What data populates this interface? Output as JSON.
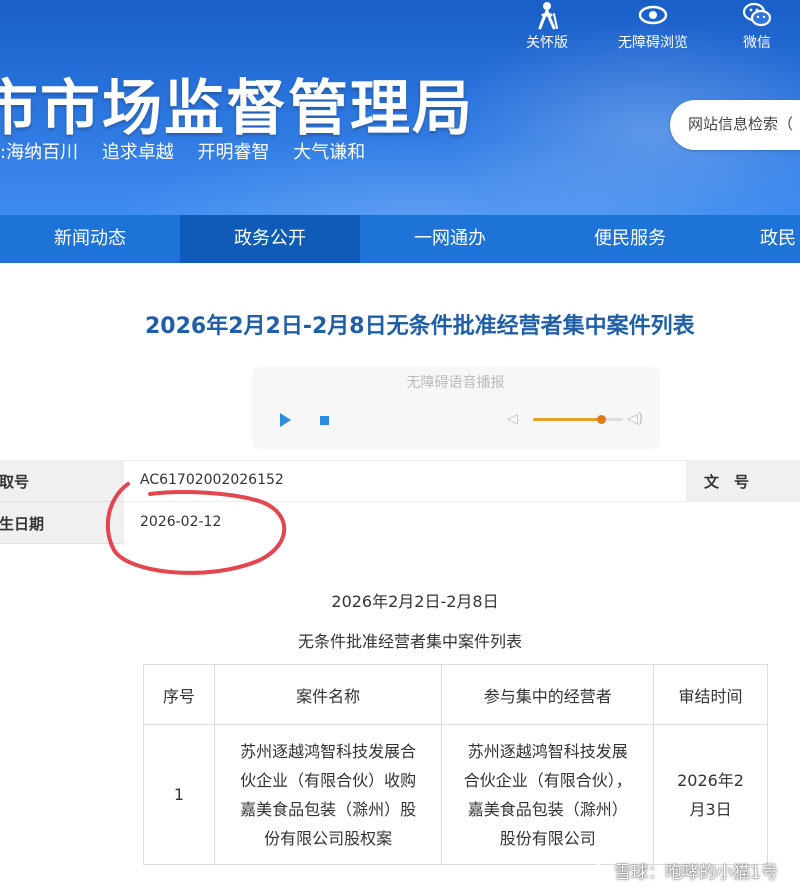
{
  "header": {
    "site_title": "市市场监督管理局",
    "slogan": [
      ":海纳百川",
      "追求卓越",
      "开明睿智",
      "大气谦和"
    ],
    "tools": [
      {
        "label": "关怀版",
        "icon": "elderly-care-icon"
      },
      {
        "label": "无障碍浏览",
        "icon": "eye-icon"
      },
      {
        "label": "微信",
        "icon": "wechat-icon"
      }
    ],
    "search_placeholder": "网站信息检索（"
  },
  "nav": {
    "items": [
      "新闻动态",
      "政务公开",
      "一网通办",
      "便民服务",
      "政民"
    ],
    "active_index": 1
  },
  "article": {
    "title": "2026年2月2日-2月8日无条件批准经营者集中案件列表",
    "player": {
      "title": "无障碍语音播报",
      "volume_level": 0.75
    },
    "meta": {
      "index_label": "索取号",
      "index_value": "AC61702002026152",
      "doc_no_label": "文　号",
      "date_label": "产生日期",
      "date_value": "2026-02-12"
    },
    "body_line1": "2026年2月2日-2月8日",
    "body_line2": "无条件批准经营者集中案件列表",
    "table": {
      "headers": [
        "序号",
        "案件名称",
        "参与集中的经营者",
        "审结时间"
      ],
      "rows": [
        {
          "num": "1",
          "name": "苏州逐越鸿智科技发展合伙企业（有限合伙）收购嘉美食品包装（滁州）股份有限公司股权案",
          "parties": "苏州逐越鸿智科技发展合伙企业（有限合伙），嘉美食品包装（滁州）股份有限公司",
          "date": "2026年2月3日"
        }
      ]
    }
  },
  "watermark": "雪球：咆哮的小猫1号",
  "colors": {
    "banner": "#2d77e0",
    "nav": "#1d73d8",
    "nav_active": "#0f5cb8",
    "title": "#1f5ea8",
    "highlight_circle": "#e0323c"
  }
}
